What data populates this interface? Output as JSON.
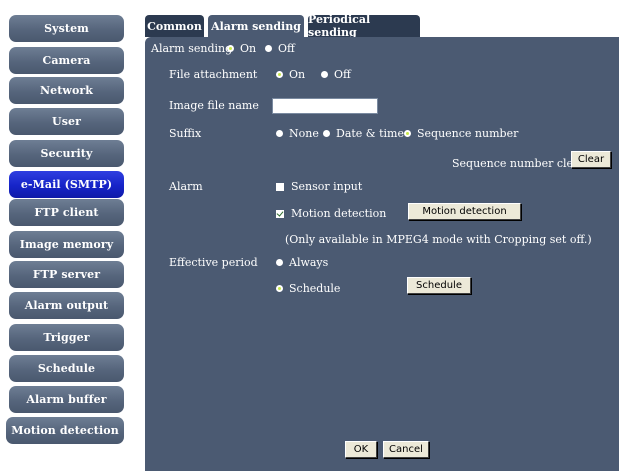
{
  "sidebar": {
    "items": [
      {
        "label": "System"
      },
      {
        "label": "Camera"
      },
      {
        "label": "Network"
      },
      {
        "label": "User"
      },
      {
        "label": "Security"
      },
      {
        "label": "e-Mail (SMTP)"
      },
      {
        "label": "FTP client"
      },
      {
        "label": "Image memory"
      },
      {
        "label": "FTP server"
      },
      {
        "label": "Alarm output"
      },
      {
        "label": "Trigger"
      },
      {
        "label": "Schedule"
      },
      {
        "label": "Alarm buffer"
      },
      {
        "label": "Motion detection"
      }
    ],
    "active_index": 5
  },
  "tabs": [
    {
      "label": "Common"
    },
    {
      "label": "Alarm sending"
    },
    {
      "label": "Periodical sending"
    }
  ],
  "form": {
    "alarm_sending": {
      "label": "Alarm sending",
      "on": "On",
      "off": "Off",
      "selected": "On"
    },
    "file_attachment": {
      "label": "File attachment",
      "on": "On",
      "off": "Off",
      "selected": "On"
    },
    "image_file_name": {
      "label": "Image file name",
      "value": ""
    },
    "suffix": {
      "label": "Suffix",
      "none": "None",
      "date_time": "Date & time",
      "sequence": "Sequence number",
      "selected": "Sequence number"
    },
    "sequence_clear": {
      "label": "Sequence number clear",
      "button": "Clear"
    },
    "alarm": {
      "label": "Alarm",
      "sensor_input": "Sensor input",
      "sensor_checked": false,
      "motion_detection": "Motion detection",
      "motion_checked": true,
      "motion_button": "Motion detection",
      "note": "(Only available in MPEG4 mode with Cropping set off.)"
    },
    "effective_period": {
      "label": "Effective period",
      "always": "Always",
      "schedule": "Schedule",
      "selected": "Schedule",
      "schedule_button": "Schedule"
    }
  },
  "footer": {
    "ok": "OK",
    "cancel": "Cancel"
  },
  "colors": {
    "panel": "#4b5a72",
    "tab_inactive": "#2c3a50",
    "sidebar_item": "#5a6880",
    "sidebar_active": "#1624c8",
    "radio_selected": "#c8e84a"
  }
}
